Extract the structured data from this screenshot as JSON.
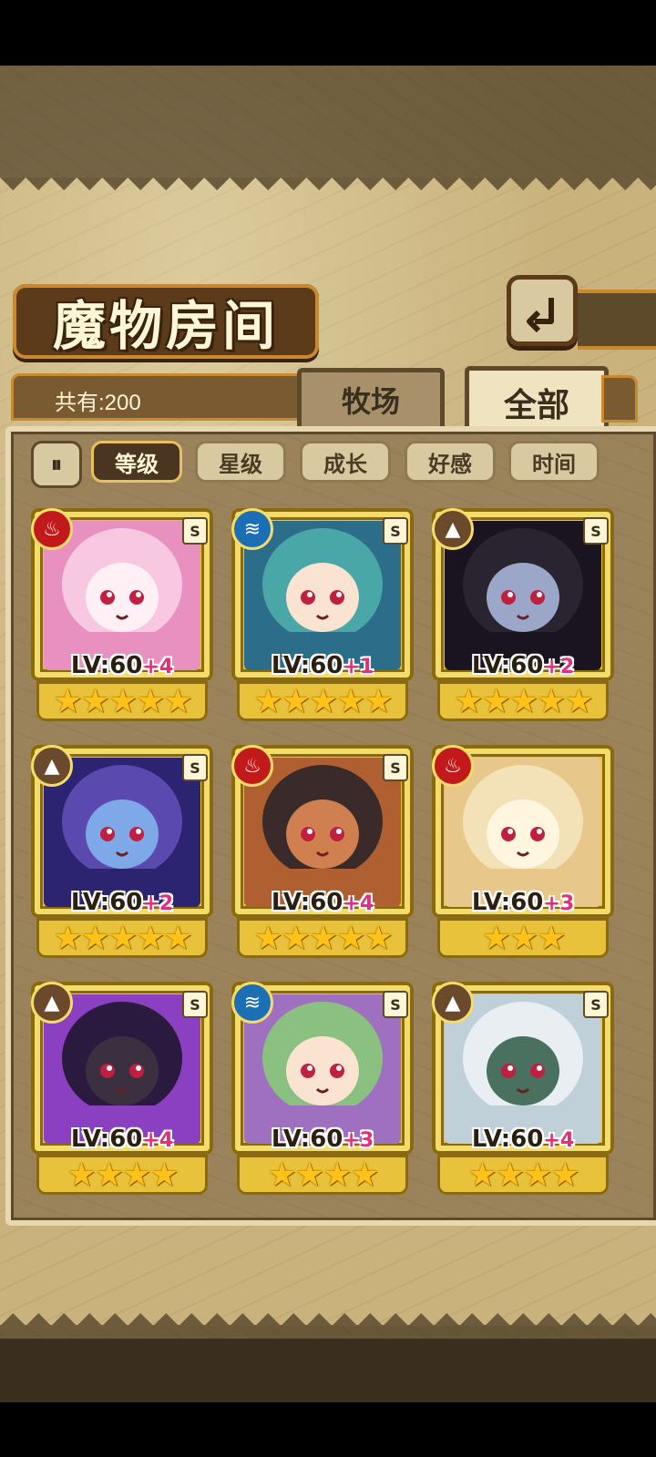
{
  "header": {
    "title": "魔物房间"
  },
  "tabs": {
    "count_label": "共有:200",
    "pasture": "牧场",
    "all": "全部"
  },
  "sort": {
    "toggle": "⏸",
    "buttons": [
      "等级",
      "星级",
      "成长",
      "好感",
      "时间"
    ],
    "active": "等级"
  },
  "colors": {
    "fire": "#c21a1a",
    "water": "#1d6fb5",
    "earth": "#6a4a2a",
    "plus": "#e0307a"
  },
  "monsters": [
    {
      "element": "fire",
      "element_icon": "flame-icon",
      "rank": "S",
      "level": "LV:60",
      "plus": "+4",
      "stars": "★★★★★"
    },
    {
      "element": "water",
      "element_icon": "wave-icon",
      "rank": "S",
      "level": "LV:60",
      "plus": "+1",
      "stars": "★★★★★"
    },
    {
      "element": "earth",
      "element_icon": "mountain-icon",
      "rank": "S",
      "level": "LV:60",
      "plus": "+2",
      "stars": "★★★★★"
    },
    {
      "element": "earth",
      "element_icon": "mountain-icon",
      "rank": "S",
      "level": "LV:60",
      "plus": "+2",
      "stars": "★★★★★"
    },
    {
      "element": "fire",
      "element_icon": "flame-icon",
      "rank": "S",
      "level": "LV:60",
      "plus": "+4",
      "stars": "★★★★★"
    },
    {
      "element": "fire",
      "element_icon": "flame-icon",
      "rank": "",
      "level": "LV:60",
      "plus": "+3",
      "stars": "★★★"
    },
    {
      "element": "earth",
      "element_icon": "mountain-icon",
      "rank": "S",
      "level": "LV:60",
      "plus": "+4",
      "stars": "★★★★"
    },
    {
      "element": "water",
      "element_icon": "wave-icon",
      "rank": "S",
      "level": "LV:60",
      "plus": "+3",
      "stars": "★★★★"
    },
    {
      "element": "earth",
      "element_icon": "mountain-icon",
      "rank": "S",
      "level": "LV:60",
      "plus": "+4",
      "stars": "★★★★"
    }
  ]
}
